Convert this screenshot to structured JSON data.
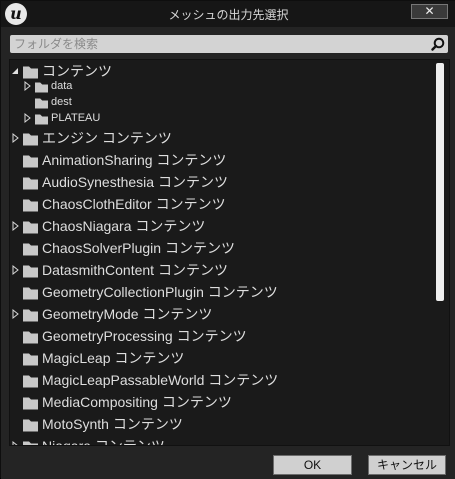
{
  "window": {
    "title": "メッシュの出力先選択",
    "logo_letter": "u",
    "close_symbol": "✕"
  },
  "search": {
    "placeholder": "フォルダを検索",
    "value": ""
  },
  "tree": {
    "items": [
      {
        "label": "コンテンツ",
        "level": 0,
        "expander": "expanded",
        "size": "large"
      },
      {
        "label": "data",
        "level": 1,
        "expander": "collapsed",
        "size": "small"
      },
      {
        "label": "dest",
        "level": 1,
        "expander": "none",
        "size": "small"
      },
      {
        "label": "PLATEAU",
        "level": 1,
        "expander": "collapsed",
        "size": "small"
      },
      {
        "label": "エンジン コンテンツ",
        "level": 0,
        "expander": "collapsed",
        "size": "large"
      },
      {
        "label": "AnimationSharing コンテンツ",
        "level": 0,
        "expander": "none",
        "size": "large"
      },
      {
        "label": "AudioSynesthesia コンテンツ",
        "level": 0,
        "expander": "none",
        "size": "large"
      },
      {
        "label": "ChaosClothEditor コンテンツ",
        "level": 0,
        "expander": "none",
        "size": "large"
      },
      {
        "label": "ChaosNiagara コンテンツ",
        "level": 0,
        "expander": "collapsed",
        "size": "large"
      },
      {
        "label": "ChaosSolverPlugin コンテンツ",
        "level": 0,
        "expander": "none",
        "size": "large"
      },
      {
        "label": "DatasmithContent コンテンツ",
        "level": 0,
        "expander": "collapsed",
        "size": "large"
      },
      {
        "label": "GeometryCollectionPlugin コンテンツ",
        "level": 0,
        "expander": "none",
        "size": "large"
      },
      {
        "label": "GeometryMode コンテンツ",
        "level": 0,
        "expander": "collapsed",
        "size": "large"
      },
      {
        "label": "GeometryProcessing コンテンツ",
        "level": 0,
        "expander": "none",
        "size": "large"
      },
      {
        "label": "MagicLeap コンテンツ",
        "level": 0,
        "expander": "none",
        "size": "large"
      },
      {
        "label": "MagicLeapPassableWorld コンテンツ",
        "level": 0,
        "expander": "none",
        "size": "large"
      },
      {
        "label": "MediaCompositing コンテンツ",
        "level": 0,
        "expander": "none",
        "size": "large"
      },
      {
        "label": "MotoSynth コンテンツ",
        "level": 0,
        "expander": "none",
        "size": "large"
      },
      {
        "label": "Niagara コンテンツ",
        "level": 0,
        "expander": "collapsed",
        "size": "large"
      }
    ]
  },
  "footer": {
    "ok_label": "OK",
    "cancel_label": "キャンセル"
  },
  "colors": {
    "window_bg": "#242424",
    "titlebar_bg": "#161616",
    "tree_bg": "#1a1a1a",
    "text": "#dedede",
    "folder": "#c8c8c8",
    "search_bg": "#d3d3d3"
  }
}
